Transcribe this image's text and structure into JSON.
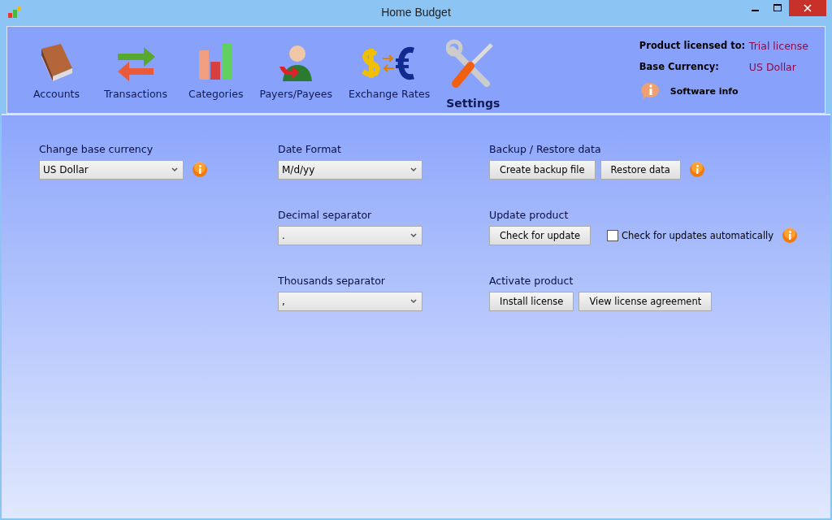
{
  "window": {
    "title": "Home Budget"
  },
  "nav": [
    {
      "kind": "accounts",
      "label": "Accounts",
      "selected": false
    },
    {
      "kind": "transactions",
      "label": "Transactions",
      "selected": false
    },
    {
      "kind": "categories",
      "label": "Categories",
      "selected": false
    },
    {
      "kind": "payees",
      "label": "Payers/Payees",
      "selected": false
    },
    {
      "kind": "exchange",
      "label": "Exchange Rates",
      "selected": false
    },
    {
      "kind": "settings",
      "label": "Settings",
      "selected": true
    }
  ],
  "license": [
    {
      "label": "Product licensed to:",
      "value": "Trial license"
    },
    {
      "label": "Base Currency:",
      "value": "US Dollar"
    }
  ],
  "software_info": "Software info",
  "columns": [
    [
      {
        "label": "Change base currency",
        "controls": [
          {
            "kind": "select",
            "value": "US Dollar"
          },
          {
            "kind": "info"
          }
        ]
      }
    ],
    [
      {
        "label": "Date Format",
        "controls": [
          {
            "kind": "select",
            "value": "M/d/yy"
          }
        ]
      },
      {
        "label": "Decimal separator",
        "controls": [
          {
            "kind": "select",
            "value": "."
          }
        ]
      },
      {
        "label": "Thousands separator",
        "controls": [
          {
            "kind": "select",
            "value": ","
          }
        ]
      }
    ],
    [
      {
        "label": "Backup / Restore data",
        "controls": [
          {
            "kind": "button",
            "label": "Create backup file"
          },
          {
            "kind": "button",
            "label": "Restore data"
          },
          {
            "kind": "info"
          }
        ]
      },
      {
        "label": "Update product",
        "controls": [
          {
            "kind": "button",
            "label": "Check for update"
          },
          {
            "kind": "checkbox",
            "label": "Check for updates automatically",
            "checked": false
          },
          {
            "kind": "info"
          }
        ]
      },
      {
        "label": "Activate product",
        "controls": [
          {
            "kind": "button",
            "label": "Install license"
          },
          {
            "kind": "button",
            "label": "View license agreement"
          }
        ]
      }
    ]
  ]
}
